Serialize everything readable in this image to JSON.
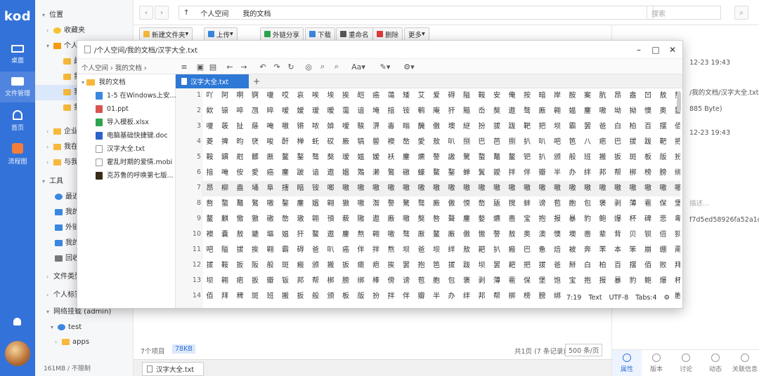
{
  "app": {
    "logo": "kod"
  },
  "leftnav": [
    {
      "label": "桌面",
      "icon": "desktop-icon"
    },
    {
      "label": "文件管理",
      "icon": "folder-icon"
    },
    {
      "label": "首页",
      "icon": "home-icon"
    },
    {
      "label": "流程图",
      "icon": "flow-icon"
    }
  ],
  "tree": {
    "items": [
      {
        "label": "位置",
        "indent": 0
      },
      {
        "label": "收藏夹",
        "indent": 1
      },
      {
        "label": "个人空间",
        "indent": 1
      },
      {
        "label": "最",
        "indent": 2
      },
      {
        "label": "我",
        "indent": 2
      },
      {
        "label": "我",
        "indent": 2
      },
      {
        "label": "我",
        "indent": 2
      },
      {
        "label": "企业",
        "indent": 1
      },
      {
        "label": "我在",
        "indent": 1
      },
      {
        "label": "与我",
        "indent": 1
      },
      {
        "label": "工具",
        "indent": 0
      },
      {
        "label": "最近",
        "indent": 1
      },
      {
        "label": "我的",
        "indent": 1
      },
      {
        "label": "外链",
        "indent": 1
      },
      {
        "label": "我的",
        "indent": 1
      },
      {
        "label": "回收",
        "indent": 1
      },
      {
        "label": "文件类型",
        "indent": 0
      },
      {
        "label": "个人标签",
        "indent": 0
      },
      {
        "label": "网络挂载 (admin)",
        "indent": 0
      },
      {
        "label": "test",
        "indent": 1
      },
      {
        "label": "apps",
        "indent": 2
      }
    ],
    "footer": "161MB / 不限制"
  },
  "topbar": {
    "crumb": [
      "个人空间",
      "我的文档"
    ],
    "search_placeholder": "搜索"
  },
  "toolbar": {
    "new_folder": "新建文件夹",
    "upload": "上传",
    "share": "外链分享",
    "download": "下载",
    "rename": "重命名",
    "delete": "删除",
    "more": "更多"
  },
  "rightpanel": {
    "date1": "12-23 19:43",
    "path": "/我的文档/汉字大全.txt",
    "size": "885 Byte)",
    "date2": "12-23 19:43",
    "desc": "描述...",
    "hash": "f7d5ed58926fa52a1ce9...",
    "tabs": [
      "属性",
      "版本",
      "讨论",
      "动态",
      "关联信息"
    ]
  },
  "status": {
    "items": "7个项目",
    "size": "78KB",
    "pages": "共1页 (7 条记录)",
    "per_page": "500 条/页"
  },
  "taskbar": {
    "item": "汉字大全.txt"
  },
  "editor": {
    "title": "/个人空间/我的文档/汉字大全.txt",
    "path": "个人空间 › 我的文档 ›",
    "files": [
      {
        "name": "我的文档",
        "type": "folder"
      },
      {
        "name": "1-5 在Windows上安...",
        "type": "video"
      },
      {
        "name": "01.ppt",
        "type": "ppt"
      },
      {
        "name": "导入模板.xlsx",
        "type": "xls"
      },
      {
        "name": "电脑基础快捷键.doc",
        "type": "doc"
      },
      {
        "name": "汉字大全.txt",
        "type": "txt"
      },
      {
        "name": "霍乱时期的爱情.mobi",
        "type": "txt"
      },
      {
        "name": "克苏鲁的呼唤第七版...",
        "type": "book"
      }
    ],
    "tab": "汉字大全.txt",
    "lines": [
      "1",
      "2",
      "3",
      "4",
      "5",
      "6",
      "7",
      "8",
      "9",
      "10",
      "11",
      "12",
      "13",
      "14"
    ],
    "text": [
      "吖阿啊锕嗄哎哀唉埃挨皑癌蔼矮艾爱碍隘鞍安俺按暗岸胺案肮昂盎凹敖熬翱袄",
      "欸锿啐乪晬嗳嫒瑷暧霭谙埯揞铵鹌庵犴黯岙獒遨骜廒翱媪鏖嗷坳拗懊奥鳌",
      "嗄荍扯蒢唵嗷锵哝媕嗳騃淠毐暡馣傲墺縌扮拔跋靶把坝霸罢爸白柏百摆佰败",
      "菱捭昀裦唆酐椫虴砹廒犒嚳襖嶅愛敖叭捌巴芭捌扒叭吧笆八疤巴拔跋靶把",
      "鞍鏆屗髒厫鳌鏊骜獒瑷媪嫒袄鏖爊謷謸驁螯鼇鳌钯扒颁般班搬扳斑板版扮",
      "揞唵侒愛癌鏖跛谙遨媼鴱濑鷔磝蠔鰲鏊蝉鬒鑀拌伴瓣半办绊邦帮梆榜膀绑",
      "昂柳盎埇阜搳暗铵啷嗷嗷嗷嗷嗷嗷嗷嗷嗷嗷嗷嗷嗷嗷嗷嗷嗷嗷嗷嗷嗷嗷嗷",
      "嗸螯鼇鷔嗷鏊鏖媼翱獓嗷潪謷驁骜廒傲愞嶅瓪撹蚌谤苞胞包褒剥薄雹保堡饱",
      "鳌麒慠獓磝嶅璈翶頇蔜隞遨廒嗷獒嗸聱鏖嫯爊嶴宝抱报暴豹鲍爆杯碑悲卑北",
      "襖嚢敖鏕塸媪犴鰲遨鏖熬翱嗷骜厫鳌廒傲慠謷敖奥澳懊墺嶴辈背贝钡倍狈备",
      "吧隘拔挨翱霸碍爸叭癌伴拌熬坝爸坝绊敖耙扒瘢巴惫焙被奔苯本笨崩绷甭泵",
      "拔鞍扳阪般斑瘢颁搬扳癍疤挨罢抱笆拔跋坝罢耙把拔爸掰白柏百摆佰败拜稗",
      "坝翱疤扳瓣钣邦帮梆膀绑棒傍谤苞胞包褒剥薄雹保堡饱宝抱报暴豹鲍爆杯碑",
      "佰拜稗斑班搬扳般颁板版扮拌伴瓣半办绊邦帮梆榜膀绑棒磅蚌镑傍谤苞胞包"
    ],
    "status": {
      "pos": "7:19",
      "mode": "Text",
      "enc": "UTF-8",
      "tabs": "Tabs:4"
    }
  }
}
